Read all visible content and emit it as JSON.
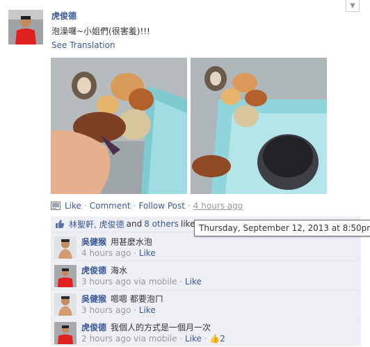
{
  "post": {
    "author": "虎俊德",
    "message": "泡澡囉~小姐們(很害羞)!!!",
    "see_translation": "See Translation"
  },
  "actions": {
    "like": "Like",
    "comment": "Comment",
    "follow": "Follow Post",
    "time": "4 hours ago",
    "separator": "·"
  },
  "likes": {
    "names": "林聖軒, 虎俊德",
    "and": "and",
    "others": "8 others",
    "like_word": "like this."
  },
  "tooltip": "Thursday, September 12, 2013 at 8:50pm",
  "comments": [
    {
      "author": "吳健猴",
      "text": "用甚麼水泡",
      "time": "4 hours ago",
      "like": "Like",
      "via": "",
      "likes_count": ""
    },
    {
      "author": "虎俊德",
      "text": "海水",
      "time": "3 hours ago",
      "via": "via mobile",
      "like": "Like",
      "likes_count": ""
    },
    {
      "author": "吳健猴",
      "text": "嗯嗯 都要泡ㄇ",
      "time": "3 hours ago",
      "like": "Like",
      "via": "",
      "likes_count": ""
    },
    {
      "author": "虎俊德",
      "text": "我個人的方式是一個月一次",
      "time": "2 hours ago",
      "via": "via mobile",
      "like": "Like",
      "likes_count": "2"
    }
  ],
  "colors": {
    "link": "#3b5998",
    "feed_bg": "#edeff4",
    "meta": "#999999"
  },
  "icons": {
    "menu": "chevron-down-icon",
    "actions": "photo-icon",
    "likes": "thumbs-up-icon"
  }
}
